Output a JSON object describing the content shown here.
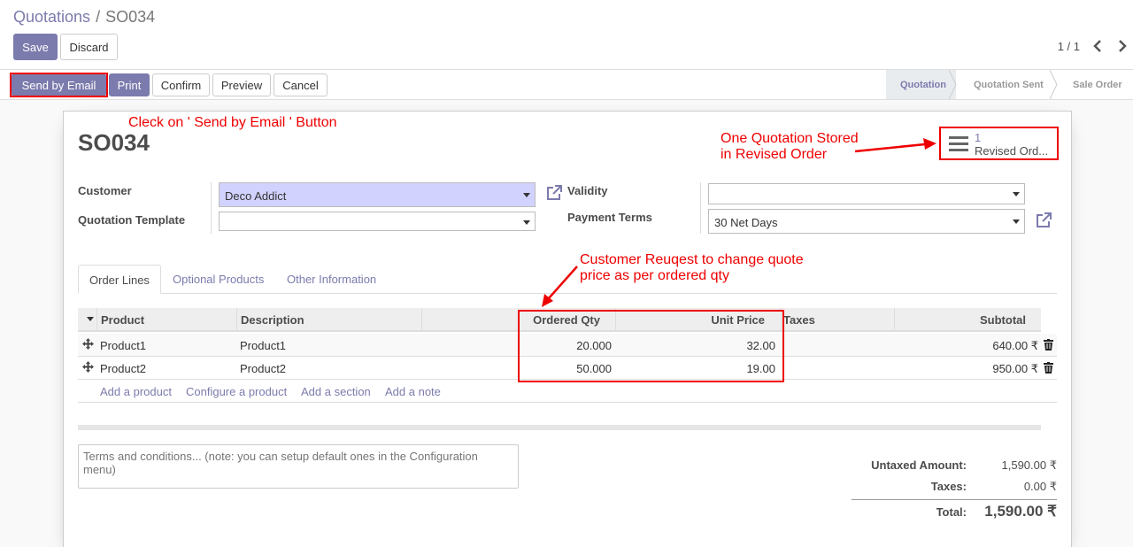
{
  "breadcrumb": {
    "parent": "Quotations",
    "separator": "/",
    "current": "SO034"
  },
  "buttons": {
    "save": "Save",
    "discard": "Discard"
  },
  "pager": {
    "value": "1 / 1"
  },
  "statusbar": {
    "send_by_email": "Send by Email",
    "print": "Print",
    "confirm": "Confirm",
    "preview": "Preview",
    "cancel": "Cancel",
    "stages": [
      "Quotation",
      "Quotation Sent",
      "Sale Order"
    ],
    "active_stage": "Quotation"
  },
  "form": {
    "title": "SO034",
    "stat_button": {
      "count": "1",
      "label": "Revised Ord..."
    },
    "customer_label": "Customer",
    "customer_value": "Deco Addict",
    "template_label": "Quotation Template",
    "template_value": "",
    "validity_label": "Validity",
    "validity_value": "",
    "payment_terms_label": "Payment Terms",
    "payment_terms_value": "30 Net Days"
  },
  "tabs": [
    "Order Lines",
    "Optional Products",
    "Other Information"
  ],
  "order_lines": {
    "columns": {
      "product": "Product",
      "description": "Description",
      "ordered_qty": "Ordered Qty",
      "unit_price": "Unit Price",
      "taxes": "Taxes",
      "subtotal": "Subtotal"
    },
    "rows": [
      {
        "product": "Product1",
        "description": "Product1",
        "qty": "20.000",
        "price": "32.00",
        "taxes": "",
        "subtotal": "640.00 ₹"
      },
      {
        "product": "Product2",
        "description": "Product2",
        "qty": "50.000",
        "price": "19.00",
        "taxes": "",
        "subtotal": "950.00 ₹"
      }
    ],
    "add_links": [
      "Add a product",
      "Configure a product",
      "Add a section",
      "Add a note"
    ]
  },
  "terms_placeholder": "Terms and conditions... (note: you can setup default ones in the Configuration menu)",
  "totals": {
    "untaxed_label": "Untaxed Amount:",
    "untaxed_value": "1,590.00 ₹",
    "taxes_label": "Taxes:",
    "taxes_value": "0.00 ₹",
    "total_label": "Total:",
    "total_value": "1,590.00 ₹"
  },
  "annotations": {
    "click_send": "Cleck on ' Send by Email ' Button",
    "stored_line1": "One Quotation Stored",
    "stored_line2": "in Revised Order",
    "request_line1": "Customer Reuqest to change quote",
    "request_line2": "price as per ordered qty"
  },
  "colors": {
    "primary": "#7c7bad",
    "annotation": "#ee0000",
    "required_field": "#d2d2ff"
  }
}
